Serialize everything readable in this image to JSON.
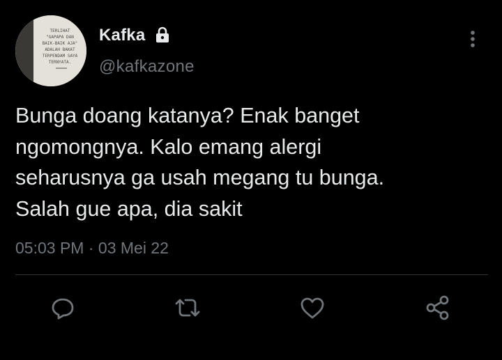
{
  "tweet": {
    "author": {
      "display_name": "Kafka",
      "handle": "@kafkazone",
      "protected_icon": "lock-icon",
      "avatar_text": [
        "TERLIHAT",
        "\"GAPAPA DAN",
        "BAIK-BAIK AJA\"",
        "ADALAH BAKAT",
        "TERPENDAM SAYA",
        "TERNYATA."
      ]
    },
    "text_lines": [
      "Bunga doang katanya? Enak banget",
      "ngomongnya. Kalo emang alergi",
      "seharusnya ga usah megang tu bunga.",
      "Salah gue apa, dia sakit"
    ],
    "time": "05:03 PM",
    "separator": "·",
    "date": "03 Mei 22",
    "actions": [
      "reply-icon",
      "retweet-icon",
      "like-icon",
      "share-icon"
    ]
  },
  "colors": {
    "background": "#000000",
    "primary_text": "#e7e9ea",
    "secondary_text": "#71767b",
    "divider": "#2f3336"
  }
}
